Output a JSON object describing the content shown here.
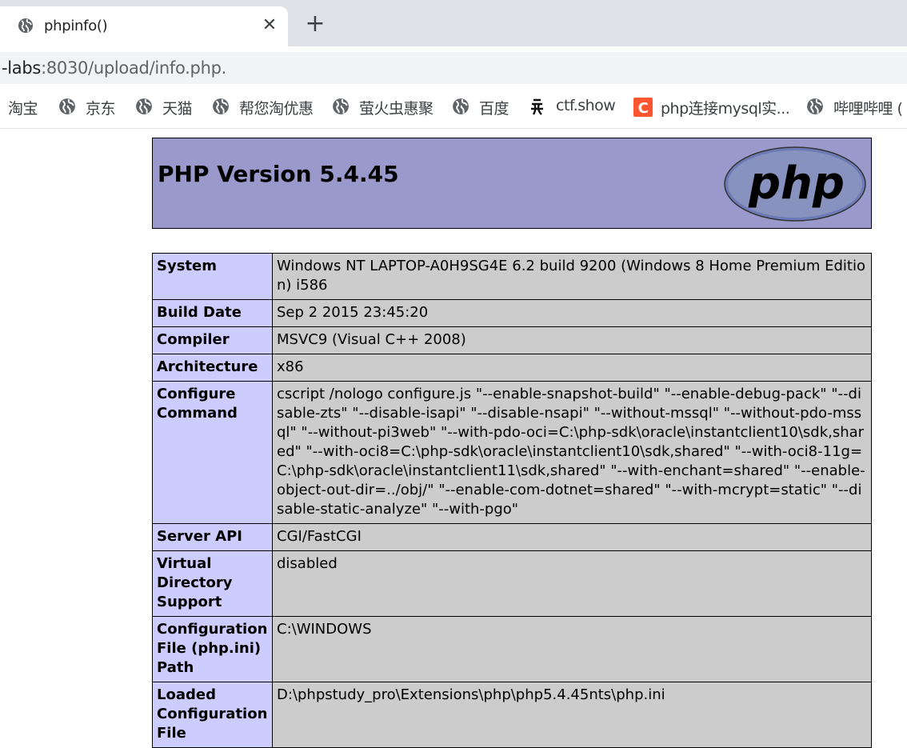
{
  "browser": {
    "tab_title": "phpinfo()",
    "url_prefix": "-labs",
    "url_rest": ":8030/upload/info.php.",
    "bookmarks": [
      {
        "label": "淘宝",
        "icon": "none"
      },
      {
        "label": "京东",
        "icon": "globe-icon"
      },
      {
        "label": "天猫",
        "icon": "globe-icon"
      },
      {
        "label": "帮您淘优惠",
        "icon": "globe-icon"
      },
      {
        "label": "萤火虫惠聚",
        "icon": "globe-icon"
      },
      {
        "label": "百度",
        "icon": "globe-icon"
      },
      {
        "label": "ctf.show",
        "icon": "ctfshow-icon"
      },
      {
        "label": "php连接mysql实...",
        "icon": "csdn-icon"
      },
      {
        "label": "哔哩哔哩 (",
        "icon": "globe-icon"
      }
    ]
  },
  "page": {
    "title": "PHP Version 5.4.45",
    "logo_text": "php",
    "rows": [
      {
        "key": "System",
        "value": "Windows NT LAPTOP-A0H9SG4E 6.2 build 9200 (Windows 8 Home Premium Edition) i586"
      },
      {
        "key": "Build Date",
        "value": "Sep 2 2015 23:45:20"
      },
      {
        "key": "Compiler",
        "value": "MSVC9 (Visual C++ 2008)"
      },
      {
        "key": "Architecture",
        "value": "x86"
      },
      {
        "key": "Configure Command",
        "value": "cscript /nologo configure.js \"--enable-snapshot-build\" \"--enable-debug-pack\" \"--disable-zts\" \"--disable-isapi\" \"--disable-nsapi\" \"--without-mssql\" \"--without-pdo-mssql\" \"--without-pi3web\" \"--with-pdo-oci=C:\\php-sdk\\oracle\\instantclient10\\sdk,shared\" \"--with-oci8=C:\\php-sdk\\oracle\\instantclient10\\sdk,shared\" \"--with-oci8-11g=C:\\php-sdk\\oracle\\instantclient11\\sdk,shared\" \"--with-enchant=shared\" \"--enable-object-out-dir=../obj/\" \"--enable-com-dotnet=shared\" \"--with-mcrypt=static\" \"--disable-static-analyze\" \"--with-pgo\""
      },
      {
        "key": "Server API",
        "value": "CGI/FastCGI"
      },
      {
        "key": "Virtual Directory Support",
        "value": "disabled"
      },
      {
        "key": "Configuration File (php.ini) Path",
        "value": "C:\\WINDOWS"
      },
      {
        "key": "Loaded Configuration File",
        "value": "D:\\phpstudy_pro\\Extensions\\php\\php5.4.45nts\\php.ini"
      }
    ]
  }
}
